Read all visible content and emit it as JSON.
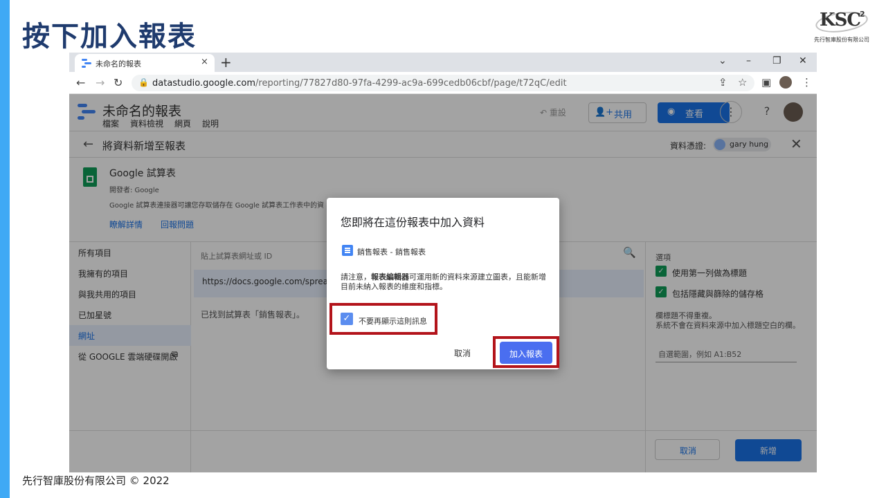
{
  "slide": {
    "title": "按下加入報表",
    "logo_text": "KSC",
    "logo_sup": "2",
    "logo_sub": "先行智庫股份有限公司",
    "footer": "先行智庫股份有限公司 © 2022"
  },
  "browser": {
    "tab_title": "未命名的報表",
    "tab_close": "×",
    "new_tab": "+",
    "url_domain": "datastudio.google.com",
    "url_path": "/reporting/77827d80-97fa-4299-ac9a-699cedb06cbf/page/t72qC/edit",
    "win_min": "–",
    "win_restore": "❐",
    "win_close": "✕",
    "chevron": "⌄"
  },
  "datastudio": {
    "report_title": "未命名的報表",
    "menu": [
      "檔案",
      "資料檢視",
      "網頁",
      "說明"
    ],
    "undo_label": "重設",
    "share_label": "共用",
    "view_label": "查看",
    "add_data_title": "將資料新增至報表",
    "credentials_label": "資料憑證:",
    "credentials_user": "gary hung",
    "connector_name": "Google 試算表",
    "connector_dev": "開發者: Google",
    "connector_desc": "Google 試算表連接器可讓您存取儲存在 Google 試算表工作表中的資",
    "link_more": "瞭解詳情",
    "link_report": "回報問題",
    "left_nav": [
      "所有項目",
      "我擁有的項目",
      "與我共用的項目",
      "已加星號",
      "網址",
      "從 GOOGLE 雲端硬碟開啟"
    ],
    "paste_label": "貼上試算表網址或 ID",
    "url_value": "https://docs.google.com/spreadshee",
    "found_text": "已找到試算表「銷售報表」。",
    "options_label": "選項",
    "option1": "使用第一列做為標題",
    "option2": "包括隱藏與篩除的儲存格",
    "note1": "欄標題不得重複。",
    "note2": "系統不會在資料來源中加入標題空白的欄。",
    "range_placeholder": "自選範圍，例如 A1:B52",
    "cancel_label": "取消",
    "add_label": "新增"
  },
  "dialog": {
    "title": "您即將在這份報表中加入資料",
    "file_name": "銷售報表 - 銷售報表",
    "note_prefix": "請注意，",
    "note_bold": "報表編輯器",
    "note_rest": "可運用新的資料來源建立圖表，且能新增目前未納入報表的維度和指標。",
    "checkbox_label": "不要再顯示這則訊息",
    "checkbox_checked": true,
    "cancel_label": "取消",
    "confirm_label": "加入報表"
  },
  "colors": {
    "accent_bar": "#3fa9f5",
    "title": "#1f3b6e",
    "highlight": "#b3141b",
    "primary_button": "#4a6ef0"
  }
}
